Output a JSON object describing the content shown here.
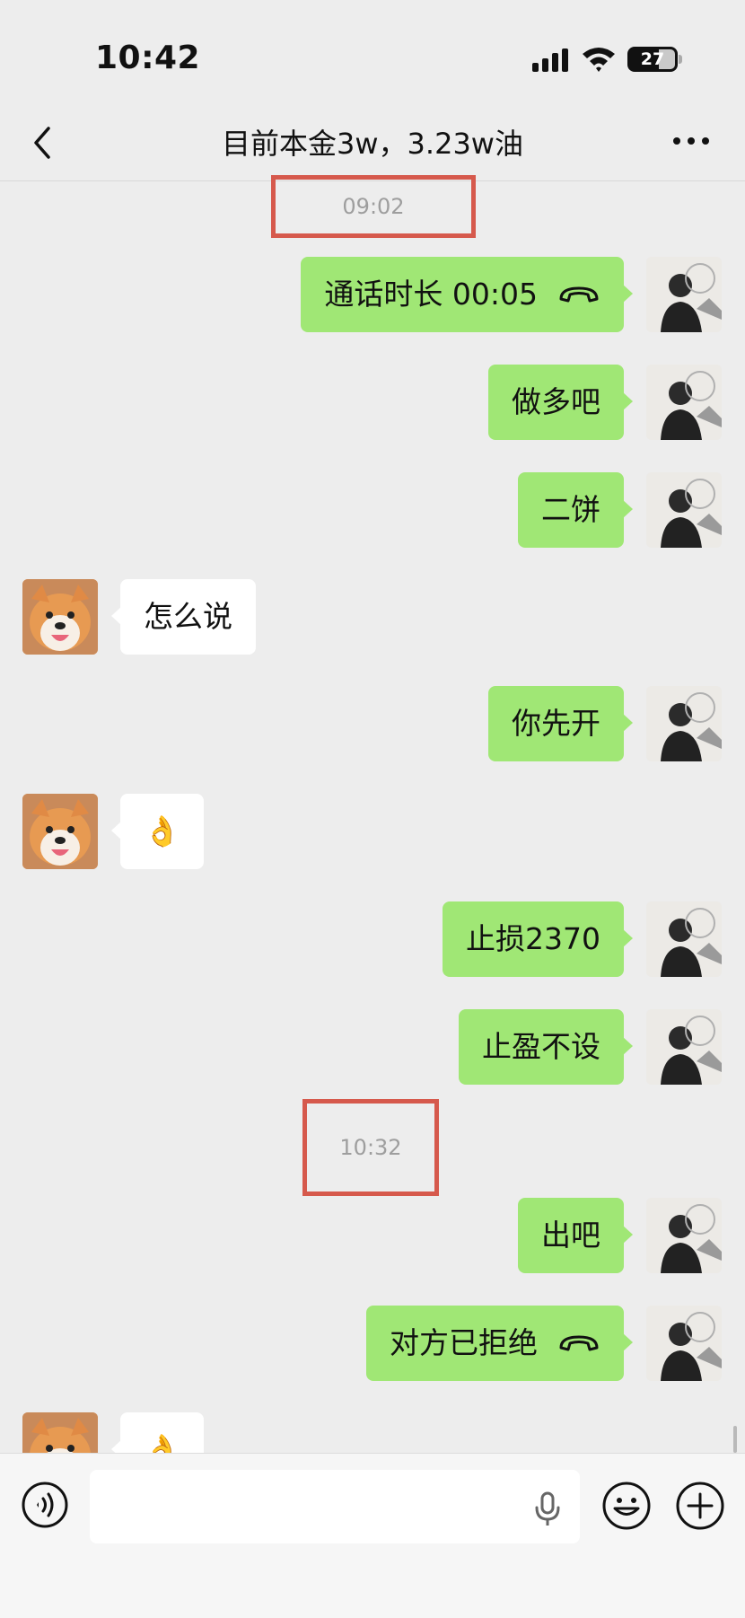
{
  "status_bar": {
    "time": "10:42",
    "battery": "27"
  },
  "nav": {
    "title": "目前本金3w，3.23w油"
  },
  "timestamps": [
    "09:02",
    "10:32"
  ],
  "messages": [
    {
      "side": "me",
      "text": "通话时长 00:05",
      "icon": "phone-hangup-icon"
    },
    {
      "side": "me",
      "text": "做多吧"
    },
    {
      "side": "me",
      "text": "二饼"
    },
    {
      "side": "other",
      "text": "怎么说"
    },
    {
      "side": "me",
      "text": "你先开"
    },
    {
      "side": "other",
      "text": "👌"
    },
    {
      "side": "me",
      "text": "止损2370"
    },
    {
      "side": "me",
      "text": "止盈不设"
    },
    {
      "side": "me",
      "text": "出吧"
    },
    {
      "side": "me",
      "text": "对方已拒绝",
      "icon": "phone-hangup-icon"
    },
    {
      "side": "other",
      "text": "👌"
    }
  ],
  "input_bar": {
    "value": "",
    "placeholder": ""
  },
  "colors": {
    "my_bubble": "#a0e775",
    "other_bubble": "#ffffff",
    "background": "#ededed",
    "highlight_box": "#d6594c"
  }
}
